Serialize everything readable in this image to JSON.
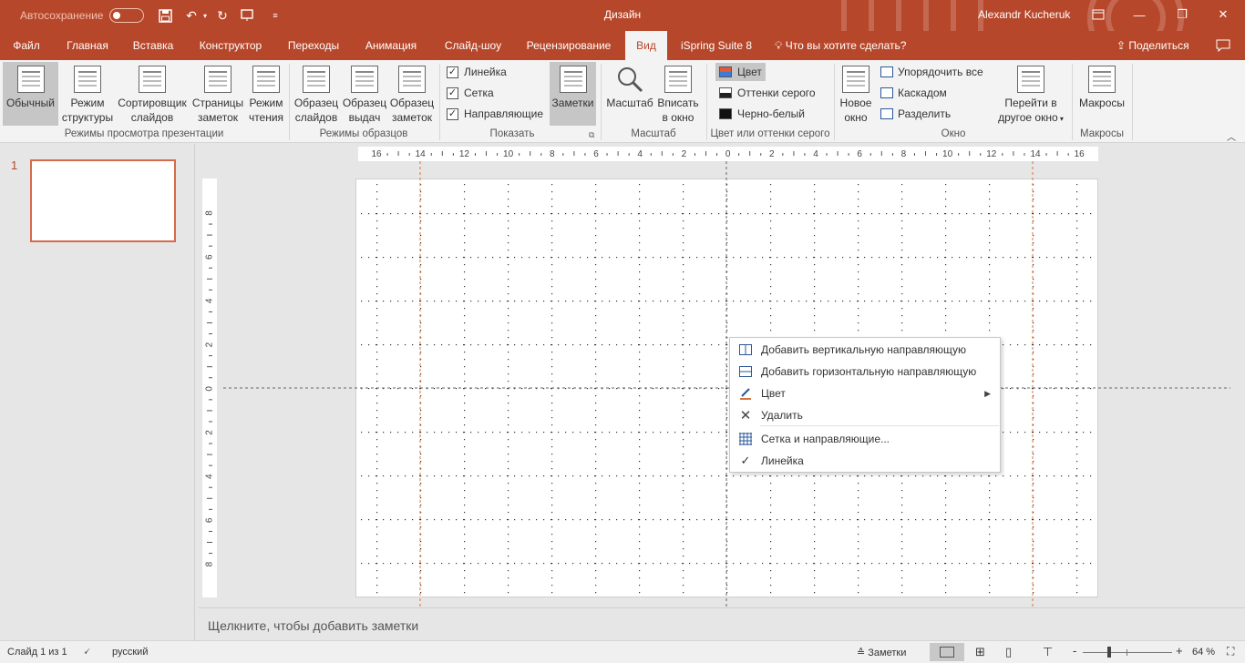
{
  "title_bar": {
    "autosave_label": "Автосохранение",
    "app_title": "Дизайн",
    "user_name": "Alexandr Kucheruk"
  },
  "tabs": [
    {
      "label": "Файл"
    },
    {
      "label": "Главная"
    },
    {
      "label": "Вставка"
    },
    {
      "label": "Конструктор"
    },
    {
      "label": "Переходы"
    },
    {
      "label": "Анимация"
    },
    {
      "label": "Слайд-шоу"
    },
    {
      "label": "Рецензирование"
    },
    {
      "label": "Вид",
      "active": true
    },
    {
      "label": "iSpring Suite 8"
    }
  ],
  "tell_me": "Что вы хотите сделать?",
  "share_label": "Поделиться",
  "ribbon": {
    "presentation_views": {
      "label": "Режимы просмотра презентации",
      "buttons": [
        {
          "l1": "Обычный",
          "l2": ""
        },
        {
          "l1": "Режим",
          "l2": "структуры"
        },
        {
          "l1": "Сортировщик",
          "l2": "слайдов"
        },
        {
          "l1": "Страницы",
          "l2": "заметок"
        },
        {
          "l1": "Режим",
          "l2": "чтения"
        }
      ]
    },
    "master_views": {
      "label": "Режимы образцов",
      "buttons": [
        {
          "l1": "Образец",
          "l2": "слайдов"
        },
        {
          "l1": "Образец",
          "l2": "выдач"
        },
        {
          "l1": "Образец",
          "l2": "заметок"
        }
      ]
    },
    "show": {
      "label": "Показать",
      "ruler": "Линейка",
      "grid": "Сетка",
      "guides": "Направляющие",
      "notes": "Заметки"
    },
    "zoom": {
      "label": "Масштаб",
      "zoom_btn": "Масштаб",
      "fit_l1": "Вписать",
      "fit_l2": "в окно"
    },
    "color": {
      "label": "Цвет или оттенки серого",
      "color": "Цвет",
      "grayscale": "Оттенки серого",
      "bw": "Черно-белый"
    },
    "window": {
      "label": "Окно",
      "new_l1": "Новое",
      "new_l2": "окно",
      "arrange": "Упорядочить все",
      "cascade": "Каскадом",
      "split": "Разделить",
      "switch_l1": "Перейти в",
      "switch_l2": "другое окно"
    },
    "macros": {
      "label": "Макросы",
      "btn": "Макросы"
    }
  },
  "slide_panel": {
    "slide_number": "1"
  },
  "rulers": {
    "horizontal": [
      "16",
      "14",
      "12",
      "10",
      "8",
      "6",
      "4",
      "2",
      "0",
      "2",
      "4",
      "6",
      "8",
      "10",
      "12",
      "14",
      "16"
    ],
    "vertical": [
      "8",
      "6",
      "4",
      "2",
      "0",
      "2",
      "4",
      "6",
      "8"
    ]
  },
  "context_menu": {
    "items": [
      {
        "label": "Добавить вертикальную направляющую",
        "icon": "vertical-guide-icon"
      },
      {
        "label": "Добавить горизонтальную направляющую",
        "icon": "horizontal-guide-icon"
      },
      {
        "label": "Цвет",
        "icon": "pen-color-icon",
        "submenu": true
      },
      {
        "label": "Удалить",
        "icon": "delete-x-icon"
      },
      {
        "label": "Сетка и направляющие...",
        "icon": "grid-icon"
      },
      {
        "label": "Линейка",
        "icon": "checkmark-icon",
        "checked": true
      }
    ]
  },
  "notes_placeholder": "Щелкните, чтобы добавить заметки",
  "status_bar": {
    "slide_info": "Слайд 1 из 1",
    "language": "русский",
    "notes_btn": "Заметки",
    "zoom_percent": "64 %",
    "zoom_minus": "-",
    "zoom_plus": "+"
  },
  "colors": {
    "accent": "#b7472a",
    "guide": "#d9743e"
  }
}
